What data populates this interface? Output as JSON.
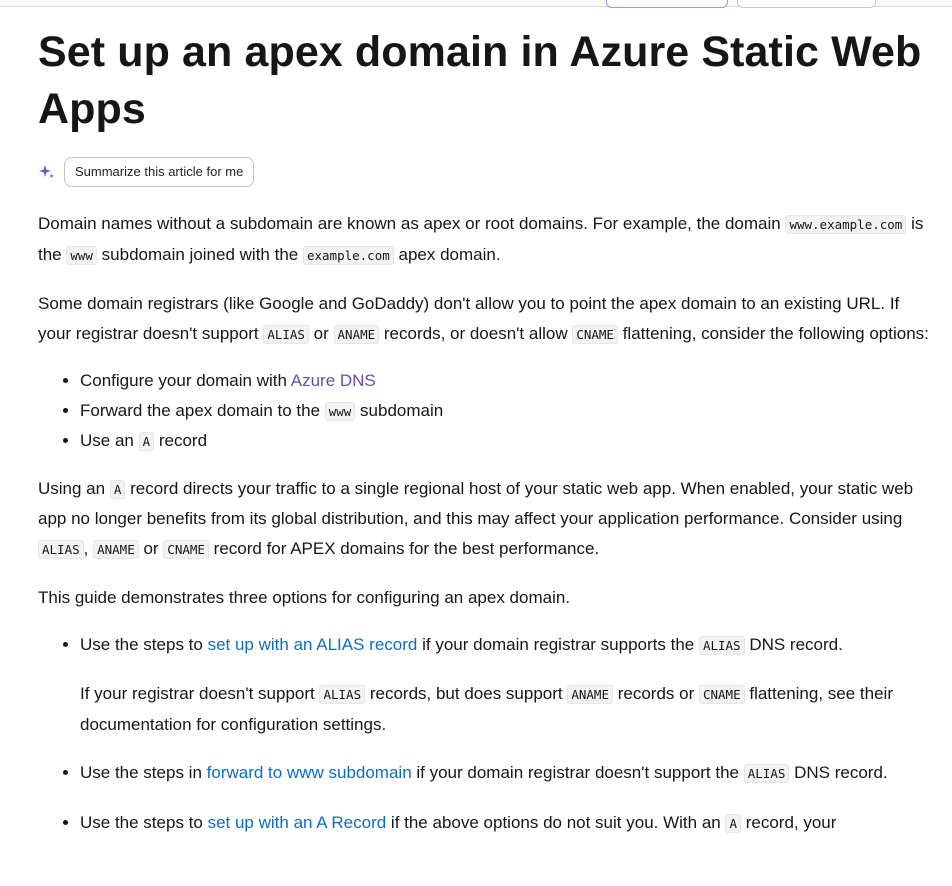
{
  "page": {
    "title": "Set up an apex domain in Azure Static Web Apps",
    "summarize_label": "Summarize this article for me"
  },
  "p1": {
    "t1": "Domain names without a subdomain are known as apex or root domains. For example, the domain ",
    "c1": "www.example.com",
    "t2": " is the ",
    "c2": "www",
    "t3": " subdomain joined with the ",
    "c3": "example.com",
    "t4": " apex domain."
  },
  "p2": {
    "t1": "Some domain registrars (like Google and GoDaddy) don't allow you to point the apex domain to an existing URL. If your registrar doesn't support ",
    "c1": "ALIAS",
    "t2": " or ",
    "c2": "ANAME",
    "t3": " records, or doesn't allow ",
    "c3": "CNAME",
    "t4": " flattening, consider the following options:"
  },
  "list1": {
    "item1_text": "Configure your domain with ",
    "item1_link": "Azure DNS",
    "item2_t1": "Forward the apex domain to the ",
    "item2_code": "www",
    "item2_t2": " subdomain",
    "item3_t1": "Use an ",
    "item3_code": "A",
    "item3_t2": " record"
  },
  "p3": {
    "t1": "Using an ",
    "c1": "A",
    "t2": " record directs your traffic to a single regional host of your static web app. When enabled, your static web app no longer benefits from its global distribution, and this may affect your application performance. Consider using ",
    "c2": "ALIAS",
    "t3": ", ",
    "c3": "ANAME",
    "t4": " or ",
    "c4": "CNAME",
    "t5": " record for APEX domains for the best performance."
  },
  "p4": {
    "text": "This guide demonstrates three options for configuring an apex domain."
  },
  "list2": {
    "i1_t1": "Use the steps to ",
    "i1_link": "set up with an ALIAS record",
    "i1_t2": " if your domain registrar supports the ",
    "i1_code": "ALIAS",
    "i1_t3": " DNS record.",
    "i1_sub_t1": "If your registrar doesn't support ",
    "i1_sub_c1": "ALIAS",
    "i1_sub_t2": " records, but does support ",
    "i1_sub_c2": "ANAME",
    "i1_sub_t3": " records or ",
    "i1_sub_c3": "CNAME",
    "i1_sub_t4": " flattening, see their documentation for configuration settings.",
    "i2_t1": "Use the steps in ",
    "i2_link": "forward to www subdomain",
    "i2_t2": " if your domain registrar doesn't support the ",
    "i2_code": "ALIAS",
    "i2_t3": " DNS record.",
    "i3_t1": "Use the steps to ",
    "i3_link": "set up with an A Record",
    "i3_t2": " if the above options do not suit you. With an ",
    "i3_code": "A",
    "i3_t3": " record, your"
  },
  "colors": {
    "link": "#0f6cbd",
    "visited_link": "#6b4ea2",
    "text": "#161616",
    "code_bg": "#f2f2f2"
  }
}
